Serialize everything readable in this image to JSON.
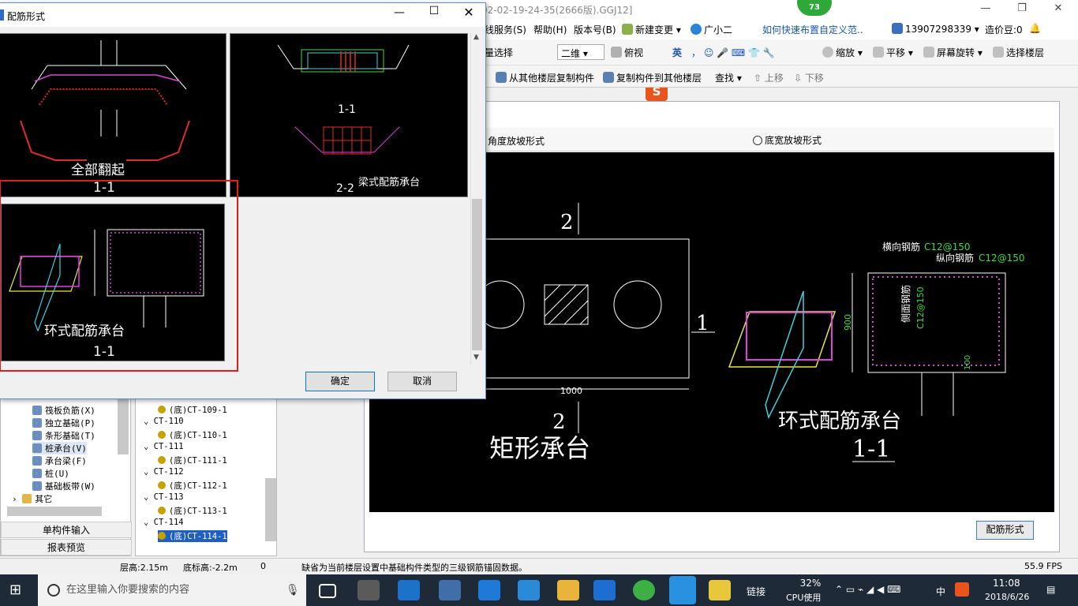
{
  "app": {
    "title_fragment": "02-02-19-24-35(2666版).GGJ12]",
    "badge": "73"
  },
  "menubar": {
    "items": [
      "线服务(S)",
      "帮助(H)",
      "版本号(B)",
      "新建变更",
      "广小二",
      "如何快速布置自定义范..",
      "13907298339",
      "造价豆:0"
    ]
  },
  "toolbar1": {
    "items": [
      "量选择",
      "二维",
      "俯视",
      "英",
      "缩放",
      "平移",
      "屏幕旋转",
      "选择楼层"
    ]
  },
  "toolbar2": {
    "items": [
      "从其他楼层复制构件",
      "复制构件到其他楼层",
      "查找",
      "上移",
      "下移"
    ]
  },
  "drawing": {
    "radio_options": [
      "角度放坡形式",
      "底宽放坡形式"
    ],
    "labels": {
      "section_2_top": "2",
      "section_2_bottom": "2",
      "section_1": "1",
      "width_dim": "1000",
      "height_dim": "900",
      "pile_dim": "100",
      "rect_title": "矩形承台",
      "ring_title": "环式配筋承台",
      "ring_section": "1-1",
      "transverse": "横向钢筋",
      "transverse_val": "C12@150",
      "longitudinal": "纵向钢筋",
      "longitudinal_val": "C12@150",
      "side_bar": "侧面钢筋",
      "side_bar_val": "C12@150"
    },
    "button": "配筋形式"
  },
  "left_panel": {
    "items": [
      "筏板负筋(X)",
      "独立基础(P)",
      "条形基础(T)",
      "桩承台(V)",
      "承台梁(F)",
      "桩(U)",
      "基础板带(W)",
      "其它"
    ],
    "buttons": [
      "单构件输入",
      "报表预览"
    ]
  },
  "mid_panel": {
    "rows": [
      {
        "text": "(底)CT-109-1",
        "level": 2
      },
      {
        "text": "CT-110",
        "level": 1
      },
      {
        "text": "(底)CT-110-1",
        "level": 2
      },
      {
        "text": "CT-111",
        "level": 1
      },
      {
        "text": "(底)CT-111-1",
        "level": 2
      },
      {
        "text": "CT-112",
        "level": 1
      },
      {
        "text": "(底)CT-112-1",
        "level": 2
      },
      {
        "text": "CT-113",
        "level": 1
      },
      {
        "text": "(底)CT-113-1",
        "level": 2
      },
      {
        "text": "CT-114",
        "level": 1
      },
      {
        "text": "(底)CT-114-1",
        "level": 2,
        "selected": true
      }
    ]
  },
  "statusbar": {
    "floor_height": "层高:2.15m",
    "bottom_elev": "底标高:-2.2m",
    "zero": "0",
    "message": "缺省为当前楼层设置中基础构件类型的三级钢筋锚固数据。",
    "fps": "55.9 FPS"
  },
  "taskbar": {
    "search_placeholder": "在这里输入你要搜索的内容",
    "link": "链接",
    "cpu_percent": "32%",
    "cpu_label": "CPU使用",
    "ime": "中",
    "time": "11:08",
    "date": "2018/6/26"
  },
  "dialog": {
    "title": "配筋形式",
    "thumbs": [
      {
        "name": "全部翻起",
        "section": "1-1"
      },
      {
        "name": "梁式配筋承台",
        "section": "2-2",
        "section_top": "1-1"
      },
      {
        "name": "环式配筋承台",
        "section": "1-1"
      }
    ],
    "ok": "确定",
    "cancel": "取消"
  },
  "colors": {
    "accent": "#0078d7",
    "selection_frame": "#e01c1c",
    "rebar_magenta": "#e040e0",
    "rebar_green": "#3ddc3d",
    "taskbar": "#1e2a38"
  }
}
